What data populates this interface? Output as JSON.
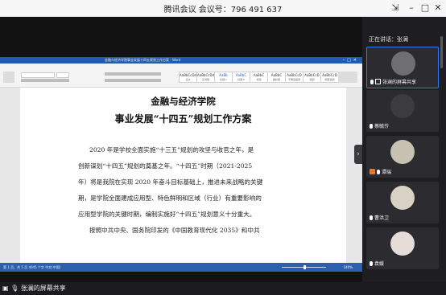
{
  "window": {
    "title": "腾讯会议 会议号：796 491 637",
    "buttons": {
      "pin": "⇲",
      "minimize": "–",
      "maximize": "□",
      "close": "✕"
    }
  },
  "document": {
    "titlebar_text": "金融与经济学院事业发展十四五规划工作方案 - Word",
    "tabs": [
      "文件",
      "开始",
      "插入",
      "设计",
      "布局",
      "引用",
      "邮件",
      "审阅",
      "视图",
      "帮助",
      "告诉我你想要做什么"
    ],
    "styles": [
      {
        "sample": "AaBbCcDd",
        "name": "正文"
      },
      {
        "sample": "AaBbCcDd",
        "name": "无间隔"
      },
      {
        "sample": "AaBb",
        "name": "标题 1"
      },
      {
        "sample": "AaBbC",
        "name": "标题 2"
      },
      {
        "sample": "AaBbC",
        "name": "标题"
      },
      {
        "sample": "AaBbC",
        "name": "副标题"
      },
      {
        "sample": "AaBbCcD",
        "name": "不明显强调"
      },
      {
        "sample": "AaBbCcD",
        "name": "强调"
      },
      {
        "sample": "AaBbCcD",
        "name": "明显强调"
      }
    ],
    "heading1": "金融与经济学院",
    "heading2": "事业发展“十四五”规划工作方案",
    "paragraph": [
      "2020 年是学校全面实施“十三五”规划的攻坚与收官之年，是",
      "创新谋划“十四五”规划的奠基之年。“十四五”时期（2021-2025",
      "年）将是我院在实现 2020 年奋斗目标基础上，推进未来战略的关键",
      "期，是学院全面建成应用型、特色鲜明和区域（行业）有重要影响的",
      "应用型学院的关键时期，编制实施好“十四五”规划意义十分重大。",
      "按照中共中央、国务院印发的《中国教育现代化 2035》和中共"
    ],
    "status_left": "第 1 页，共 5 页    4045 个字    中文(中国)",
    "zoom": "140%"
  },
  "sidebar": {
    "speaking_label": "正在讲话：张澜",
    "participants": [
      {
        "name": "张澜的屏幕共享",
        "active": true,
        "icons": [
          "mic",
          "screen"
        ]
      },
      {
        "name": "蔡毓芬",
        "active": false,
        "icons": [
          "mic"
        ]
      },
      {
        "name": "谭瑞",
        "active": false,
        "icons": [
          "host",
          "mic"
        ]
      },
      {
        "name": "曹洪卫",
        "active": false,
        "icons": [
          "mic"
        ]
      },
      {
        "name": "袁媛",
        "active": false,
        "icons": [
          "mic"
        ]
      }
    ]
  },
  "bottom": {
    "share_label": "张澜的屏幕共享"
  },
  "colors": {
    "accent": "#2f7bf5",
    "word_blue": "#2b5fb8",
    "host": "#e9772b"
  }
}
